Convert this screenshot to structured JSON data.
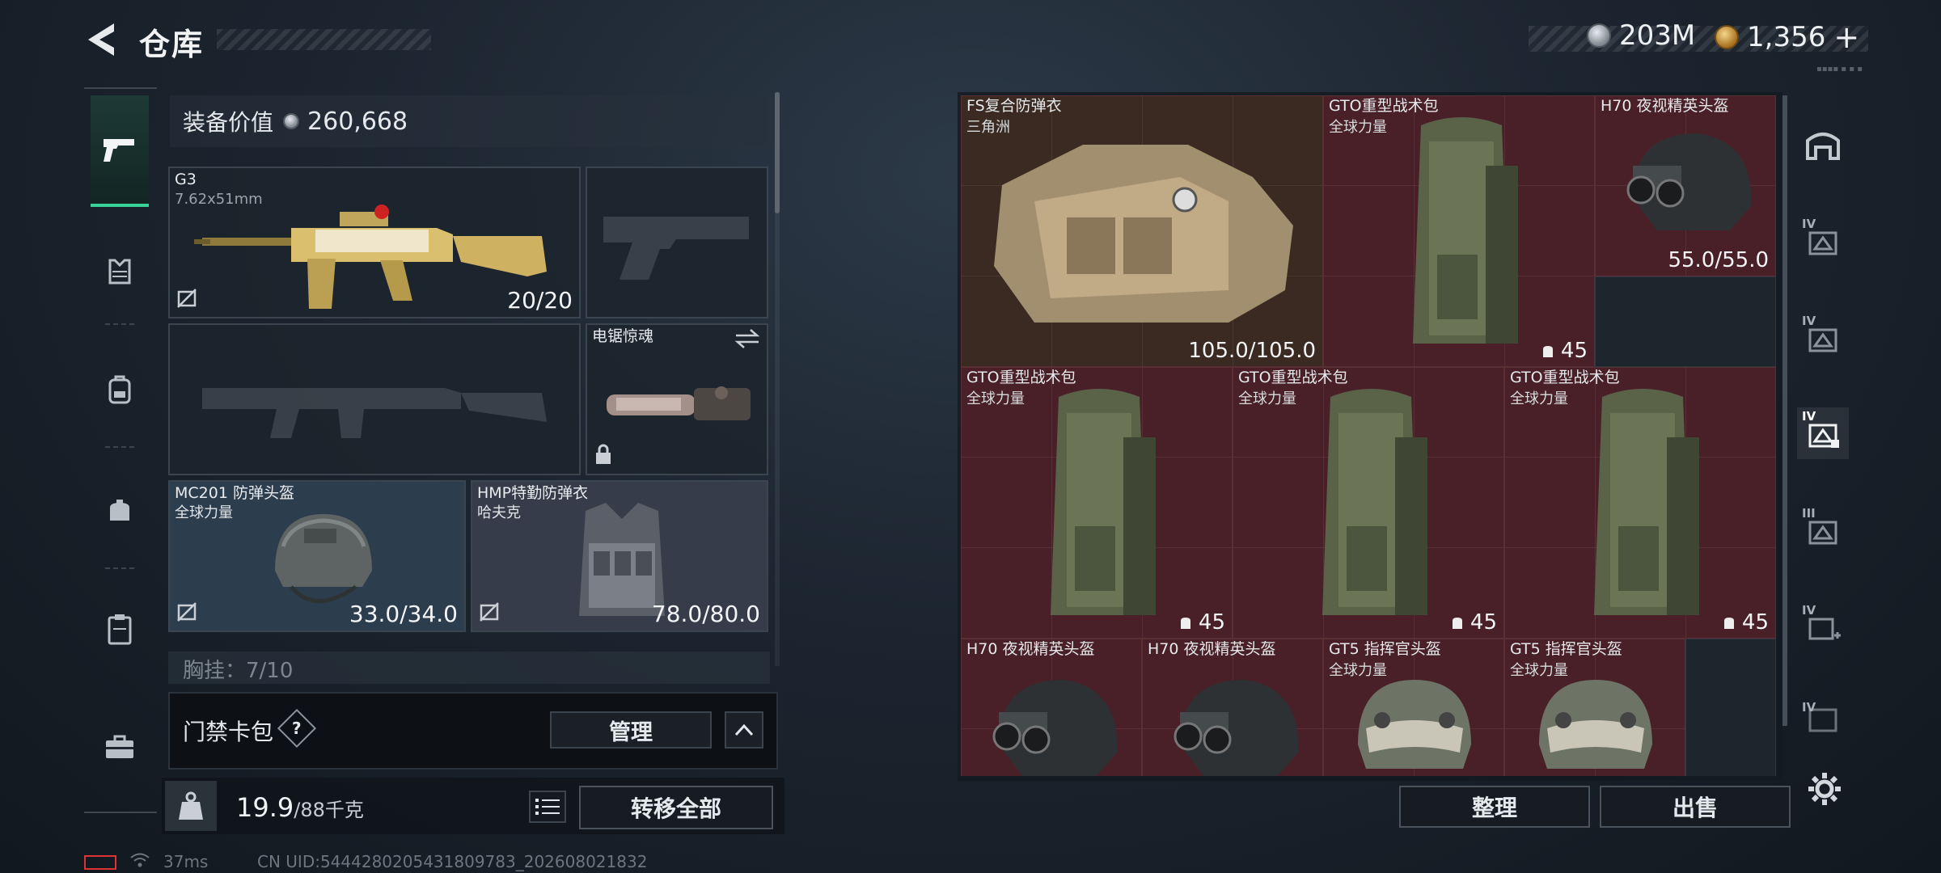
{
  "header": {
    "title": "仓库",
    "currency_silver": "203M",
    "currency_gold": "1,356",
    "add_symbol": "+"
  },
  "left": {
    "equipment_value_label": "装备价值",
    "equipment_value": "260,668",
    "slots": {
      "primary": {
        "name": "G3",
        "caliber": "7.62x51mm",
        "ammo": "20/20"
      },
      "melee": {
        "name": "电锯惊魂"
      },
      "helmet": {
        "name": "MC201 防弹头盔",
        "faction": "全球力量",
        "durability": "33.0/34.0"
      },
      "armor": {
        "name": "HMP特勤防弹衣",
        "faction": "哈夫克",
        "durability": "78.0/80.0"
      }
    },
    "chest_rig_partial": "胸挂：7/10",
    "keycard": {
      "label": "门禁卡包",
      "help": "?",
      "manage": "管理"
    },
    "weight": {
      "current": "19.9",
      "max": "/88千克"
    },
    "transfer_all": "转移全部"
  },
  "status": {
    "ping": "37ms",
    "uid": "CN UID:5444280205431809783_202608021832"
  },
  "grid": {
    "items": [
      {
        "name": "FS复合防弹衣",
        "sub": "三角洲",
        "value": "105.0/105.0"
      },
      {
        "name": "GTO重型战术包",
        "sub": "全球力量",
        "capacity": "45"
      },
      {
        "name": "H70 夜视精英头盔",
        "value": "55.0/55.0"
      },
      {
        "name": "GTO重型战术包",
        "sub": "全球力量",
        "capacity": "45"
      },
      {
        "name": "GTO重型战术包",
        "sub": "全球力量",
        "capacity": "45"
      },
      {
        "name": "GTO重型战术包",
        "sub": "全球力量",
        "capacity": "45"
      },
      {
        "name": "H70 夜视精英头盔"
      },
      {
        "name": "H70 夜视精英头盔"
      },
      {
        "name": "GT5 指挥官头盔",
        "sub": "全球力量"
      },
      {
        "name": "GT5 指挥官头盔",
        "sub": "全球力量"
      }
    ],
    "sort": "整理",
    "sell": "出售"
  },
  "rail": {
    "labels": [
      "IV",
      "IV",
      "IV",
      "III",
      "IV",
      "IV"
    ]
  },
  "colors": {
    "accent": "#39d39a",
    "red_cell": "#4a2028",
    "brown_cell": "#3a2a22"
  }
}
